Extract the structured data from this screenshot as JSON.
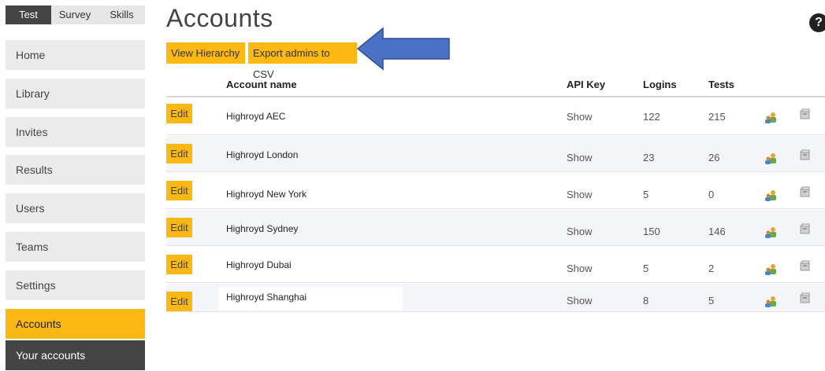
{
  "top_tabs": [
    "Test",
    "Survey",
    "Skills"
  ],
  "sidebar": {
    "items": [
      "Home",
      "Library",
      "Invites",
      "Results",
      "Users",
      "Teams",
      "Settings",
      "Accounts"
    ],
    "active": "Accounts",
    "sub_item": "Your accounts"
  },
  "page": {
    "title": "Accounts",
    "help_label": "?",
    "view_hierarchy_label": "View Hierarchy",
    "export_label": "Export admins to CSV"
  },
  "table": {
    "headers": {
      "name": "Account name",
      "api": "API Key",
      "logins": "Logins",
      "tests": "Tests"
    },
    "edit_label": "Edit",
    "rows": [
      {
        "name": "Highroyd AEC",
        "api": "Show",
        "logins": "122",
        "tests": "215"
      },
      {
        "name": "Highroyd London",
        "api": "Show",
        "logins": "23",
        "tests": "26"
      },
      {
        "name": "Highroyd New York",
        "api": "Show",
        "logins": "5",
        "tests": "0"
      },
      {
        "name": "Highroyd Sydney",
        "api": "Show",
        "logins": "150",
        "tests": "146"
      },
      {
        "name": "Highroyd Dubai",
        "api": "Show",
        "logins": "5",
        "tests": "2"
      },
      {
        "name": "Highroyd Shanghai",
        "api": "Show",
        "logins": "8",
        "tests": "5"
      }
    ]
  },
  "colors": {
    "accent": "#fbb812",
    "dark": "#444444",
    "arrow": "#4a72c4"
  }
}
